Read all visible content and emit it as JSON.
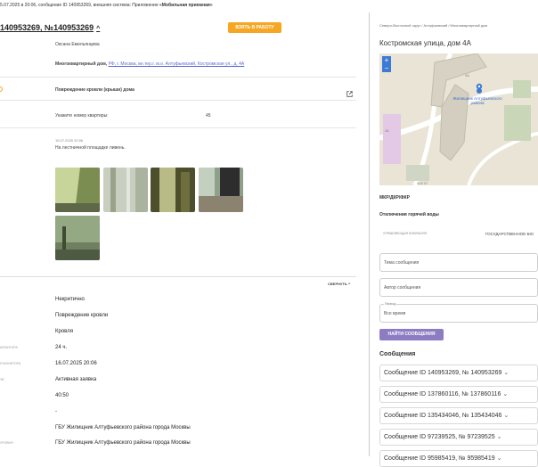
{
  "header": {
    "topline_prefix": "5.07.2025 в 20:06, сообщение ID 140953269, внешняя система: Приложение ",
    "topline_app": "«Мобильная приемная»",
    "title": "140953269, №140953269",
    "work_button": "ВЗЯТЬ В РАБОТУ"
  },
  "request": {
    "author": "Оксана Емельянцева",
    "object_type": "Многоквартирный дом,",
    "object_address": "РФ, г. Москва, вн.тер.г. м.о. Алтуфьевский, Костромская ул., д. 4А",
    "problem": "Повреждение кровли (крыши) дома",
    "apartment_label": "Укажите номер квартиры:",
    "apartment_value": "45",
    "comment_date": "15.07.2025 20:06",
    "comment_text": "На лестничной площадке ливень."
  },
  "details": {
    "collapse_label": "СВЕРНУТЬ",
    "rows": [
      {
        "label": "",
        "value": "Некритично"
      },
      {
        "label": "",
        "value": "Повреждение кровли"
      },
      {
        "label": "",
        "value": "Кровля"
      },
      {
        "label": "МОНИТОРА",
        "value": "24 ч."
      },
      {
        "label": "Я МОНИТОРА",
        "value": "16.07.2025 20:06"
      },
      {
        "label": "ЭК",
        "value": "Активная заявка"
      },
      {
        "label": "",
        "value": "40:50"
      },
      {
        "label": "",
        "value": "-"
      },
      {
        "label": "",
        "value": "ГБУ Жилищник Алтуфьевского района города Москвы"
      },
      {
        "label": "УРОВНЯ",
        "value": "ГБУ Жилищник Алтуфьевского района города Москвы"
      }
    ]
  },
  "sidebar": {
    "breadcrumb": "Северо-Восточный округ / Алтуфьевский / Многоквартирный дом",
    "address": "Костромская улица, дом 4А",
    "map": {
      "zoom_in": "+",
      "zoom_out": "−",
      "label_district": "Жилищник Алтуфьевского района",
      "label_4a": "4А",
      "label_4b": "4Б",
      "label_corner": "528 07"
    },
    "house_type": "МКР/ДКР/ФКР",
    "outage": "Отключения горячей воды",
    "mgmt_label": "УПРАВЛЯЮЩАЯ КОМПАНИЯ",
    "mgmt_value": "ГОСУДАРСТВЕННОЕ БЮ",
    "topic_placeholder": "Тема сообщения",
    "author_placeholder": "Автор сообщения",
    "period_label": "Период",
    "period_value": "Все время",
    "find_button": "НАЙТИ СООБЩЕНИЯ",
    "messages_title": "Сообщения",
    "messages": [
      "Сообщение ID 140953269, № 140953269",
      "Сообщение ID 137860116, № 137860116",
      "Сообщение ID 135434046, № 135434046",
      "Сообщение ID 97239525, № 97239525",
      "Сообщение ID 95985419, № 95985419"
    ]
  },
  "colors": {
    "accent_orange": "#f5a623",
    "accent_purple": "#8e7cc3",
    "link": "#5b6bd4"
  },
  "icons": [
    "chevron-up-icon",
    "external-link-icon",
    "chevron-down-icon",
    "map-pin-icon"
  ]
}
